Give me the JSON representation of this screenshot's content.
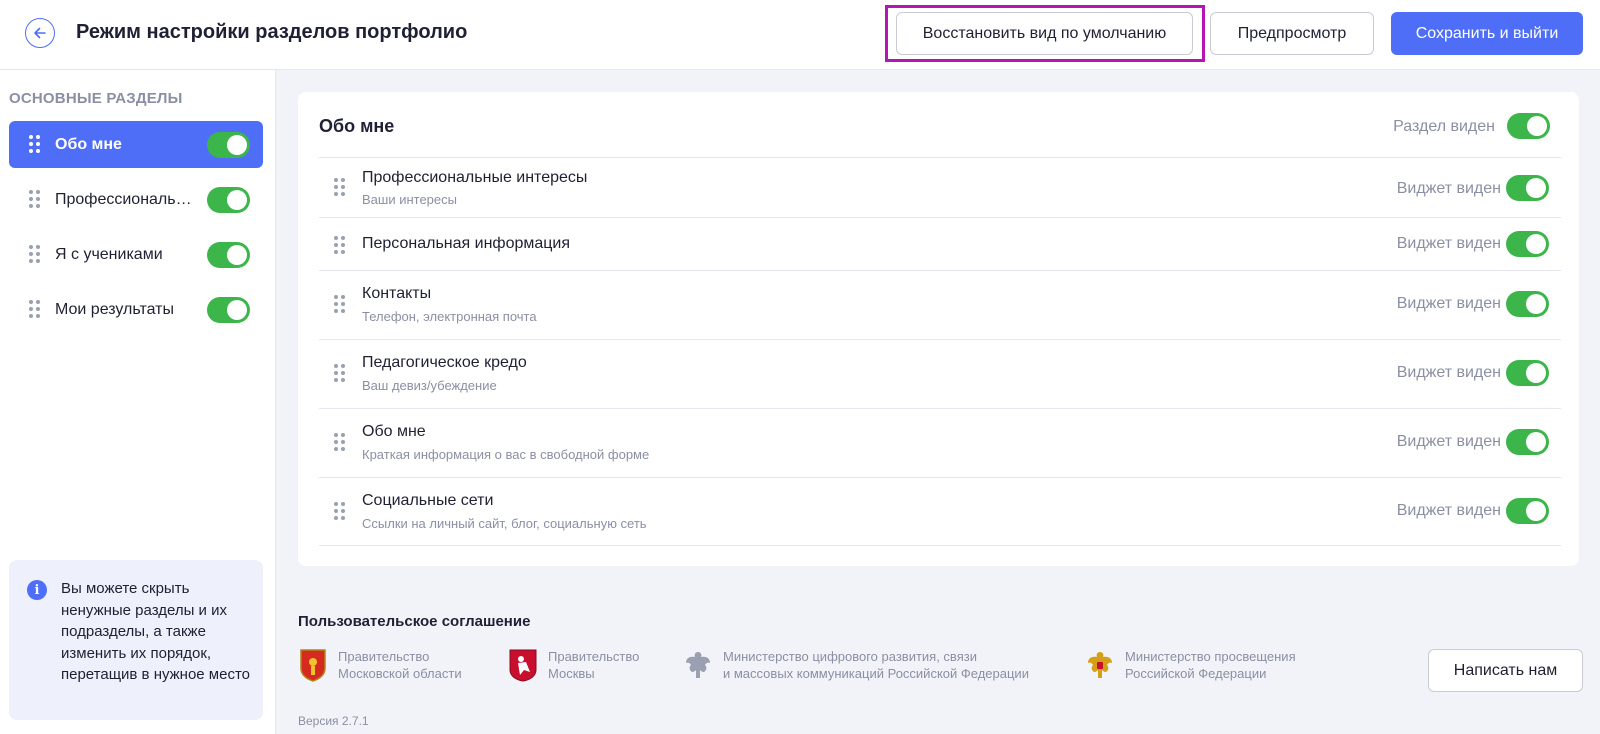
{
  "header": {
    "title": "Режим настройки разделов портфолио",
    "restore_label": "Восстановить вид по умолчанию",
    "preview_label": "Предпросмотр",
    "save_label": "Сохранить и выйти",
    "icons": {
      "back": "arrow-left-circle-icon"
    },
    "colors": {
      "accent": "#4f6ef7",
      "highlight": "#b515b5"
    }
  },
  "sidebar": {
    "heading": "ОСНОВНЫЕ РАЗДЕЛЫ",
    "items": [
      {
        "label": "Обо мне",
        "active": true,
        "enabled": true
      },
      {
        "label": "Профессиональные интересы",
        "active": false,
        "enabled": true
      },
      {
        "label": "Я с учениками",
        "active": false,
        "enabled": true
      },
      {
        "label": "Мои результаты",
        "active": false,
        "enabled": true
      }
    ],
    "info": "Вы можете скрыть ненужные разделы и их подразделы, а также изменить их порядок, перетащив в нужное место",
    "info_icon": "i"
  },
  "section": {
    "title": "Обо мне",
    "status": "Раздел виден",
    "enabled": true,
    "widgets": [
      {
        "title": "Профессиональные интересы",
        "subtitle": "Ваши интересы",
        "status": "Виджет виден",
        "enabled": true
      },
      {
        "title": "Персональная информация",
        "subtitle": "",
        "status": "Виджет виден",
        "enabled": true
      },
      {
        "title": "Контакты",
        "subtitle": "Телефон, электронная почта",
        "status": "Виджет виден",
        "enabled": true
      },
      {
        "title": "Педагогическое кредо",
        "subtitle": "Ваш девиз/убеждение",
        "status": "Виджет виден",
        "enabled": true
      },
      {
        "title": "Обо мне",
        "subtitle": "Краткая информация о вас в свободной форме",
        "status": "Виджет виден",
        "enabled": true
      },
      {
        "title": "Социальные сети",
        "subtitle": "Ссылки на личный сайт, блог, социальную сеть",
        "status": "Виджет виден",
        "enabled": true
      }
    ],
    "colors": {
      "toggle_on": "#3cb54a"
    }
  },
  "footer": {
    "agreement": "Пользовательское соглашение",
    "orgs": [
      {
        "name": "Правительство\nМосковской области",
        "icon": "moscow-region-coat-of-arms-icon"
      },
      {
        "name": "Правительство\nМосквы",
        "icon": "moscow-coat-of-arms-icon"
      },
      {
        "name": "Министерство цифрового развития, связи\nи массовых коммуникаций Российской Федерации",
        "icon": "russian-eagle-emblem-icon"
      },
      {
        "name": "Министерство просвещения\nРоссийской Федерации",
        "icon": "russian-eagle-gold-emblem-icon"
      }
    ],
    "write_label": "Написать нам",
    "version": "Версия 2.7.1"
  }
}
